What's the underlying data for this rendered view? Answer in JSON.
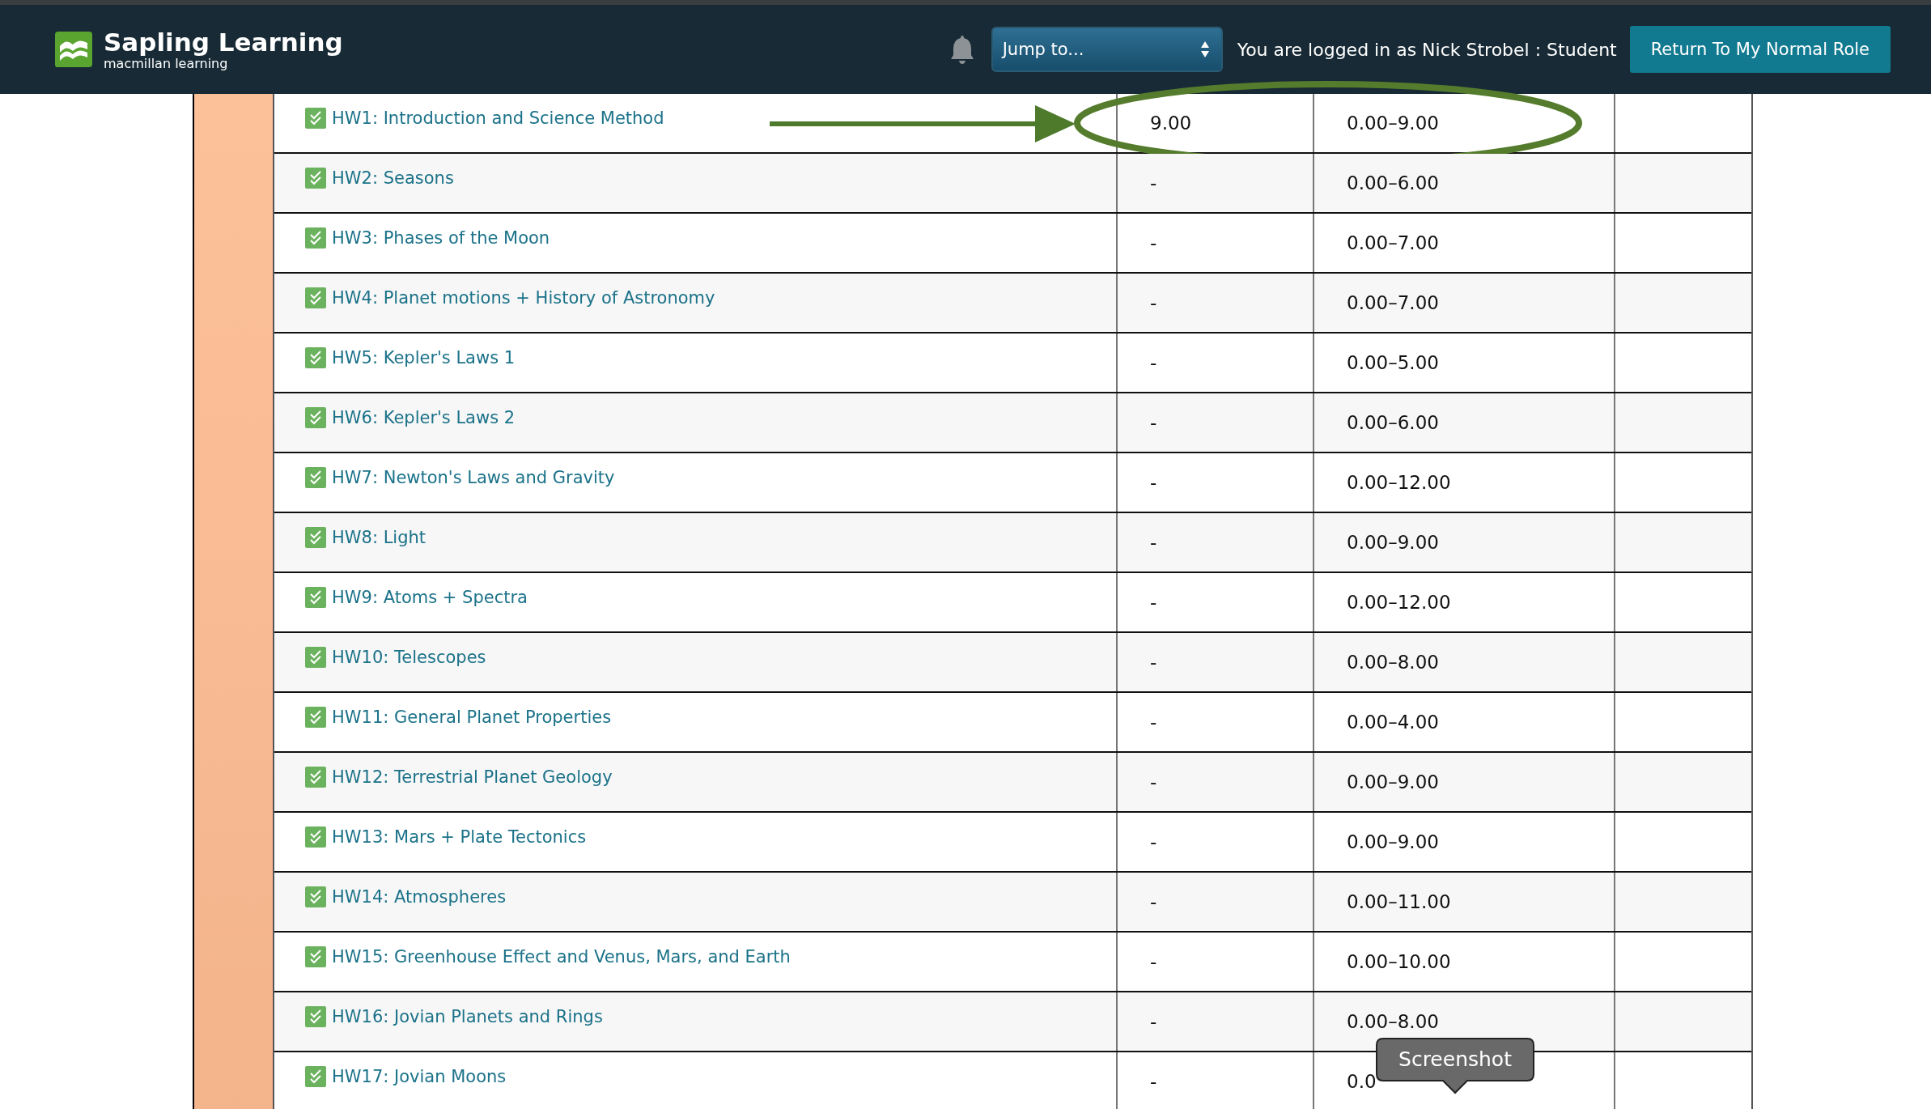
{
  "header": {
    "logo_title": "Sapling Learning",
    "logo_subtitle": "macmillan learning",
    "jump_to": {
      "value": "Jump to..."
    },
    "logged_in_text": "You are logged in as Nick Strobel : Student",
    "return_button": "Return To My Normal Role"
  },
  "assignments": [
    {
      "name": "HW1: Introduction and Science Method",
      "score": "9.00",
      "range": "0.00–9.00",
      "completed": true,
      "highlighted": true
    },
    {
      "name": "HW2: Seasons",
      "score": "-",
      "range": "0.00–6.00",
      "completed": true,
      "highlighted": false
    },
    {
      "name": "HW3: Phases of the Moon",
      "score": "-",
      "range": "0.00–7.00",
      "completed": true,
      "highlighted": false
    },
    {
      "name": "HW4: Planet motions + History of Astronomy",
      "score": "-",
      "range": "0.00–7.00",
      "completed": true,
      "highlighted": false
    },
    {
      "name": "HW5: Kepler's Laws 1",
      "score": "-",
      "range": "0.00–5.00",
      "completed": true,
      "highlighted": false
    },
    {
      "name": "HW6: Kepler's Laws 2",
      "score": "-",
      "range": "0.00–6.00",
      "completed": true,
      "highlighted": false
    },
    {
      "name": "HW7: Newton's Laws and Gravity",
      "score": "-",
      "range": "0.00–12.00",
      "completed": true,
      "highlighted": false
    },
    {
      "name": "HW8: Light",
      "score": "-",
      "range": "0.00–9.00",
      "completed": true,
      "highlighted": false
    },
    {
      "name": "HW9: Atoms + Spectra",
      "score": "-",
      "range": "0.00–12.00",
      "completed": true,
      "highlighted": false
    },
    {
      "name": "HW10: Telescopes",
      "score": "-",
      "range": "0.00–8.00",
      "completed": true,
      "highlighted": false
    },
    {
      "name": "HW11: General Planet Properties",
      "score": "-",
      "range": "0.00–4.00",
      "completed": true,
      "highlighted": false
    },
    {
      "name": "HW12: Terrestrial Planet Geology",
      "score": "-",
      "range": "0.00–9.00",
      "completed": true,
      "highlighted": false
    },
    {
      "name": "HW13: Mars + Plate Tectonics",
      "score": "-",
      "range": "0.00–9.00",
      "completed": true,
      "highlighted": false
    },
    {
      "name": "HW14: Atmospheres",
      "score": "-",
      "range": "0.00–11.00",
      "completed": true,
      "highlighted": false
    },
    {
      "name": "HW15: Greenhouse Effect and Venus, Mars, and Earth",
      "score": "-",
      "range": "0.00–10.00",
      "completed": true,
      "highlighted": false
    },
    {
      "name": "HW16: Jovian Planets and Rings",
      "score": "-",
      "range": "0.00–8.00",
      "completed": true,
      "highlighted": false
    },
    {
      "name": "HW17: Jovian Moons",
      "score": "-",
      "range": "0.0",
      "completed": true,
      "highlighted": false
    }
  ],
  "tooltip": {
    "text": "Screenshot"
  }
}
